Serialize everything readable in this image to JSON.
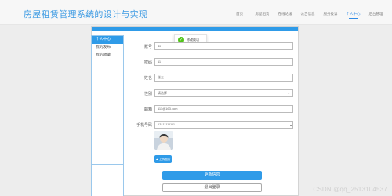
{
  "header": {
    "site_title": "房屋租赁管理系统的设计与实现",
    "nav": [
      {
        "label": "首页",
        "active": false
      },
      {
        "label": "房屋租赁",
        "active": false
      },
      {
        "label": "在线论坛",
        "active": false
      },
      {
        "label": "公告信息",
        "active": false
      },
      {
        "label": "服务投诉",
        "active": false
      },
      {
        "label": "个人中心",
        "active": true
      },
      {
        "label": "后台管理",
        "active": false
      }
    ]
  },
  "sidebar": {
    "items": [
      {
        "label": "个人中心",
        "active": true
      },
      {
        "label": "我的发布",
        "active": false
      },
      {
        "label": "我的收藏",
        "active": false
      }
    ]
  },
  "toast": {
    "icon": "check-circle-icon",
    "text": "修改成功",
    "color": "#52c41a"
  },
  "form": {
    "account": {
      "label": "账号",
      "value": "11"
    },
    "password": {
      "label": "密码",
      "value": "11"
    },
    "name": {
      "label": "姓名",
      "value": "张三"
    },
    "gender": {
      "label": "性别",
      "value": "请选择"
    },
    "email": {
      "label": "邮箱",
      "value": "111@163.com"
    },
    "phone": {
      "label": "手机号码",
      "value": "13111111111"
    }
  },
  "avatar": {
    "upload_label": "上传图片",
    "upload_icon": "cloud-upload-icon"
  },
  "actions": {
    "save_label": "更新信息",
    "logout_label": "退出登录"
  },
  "watermark": "CSDN @qq_2513104537",
  "colors": {
    "accent": "#2f9be8",
    "title": "#3d9be3",
    "success": "#52c41a"
  }
}
